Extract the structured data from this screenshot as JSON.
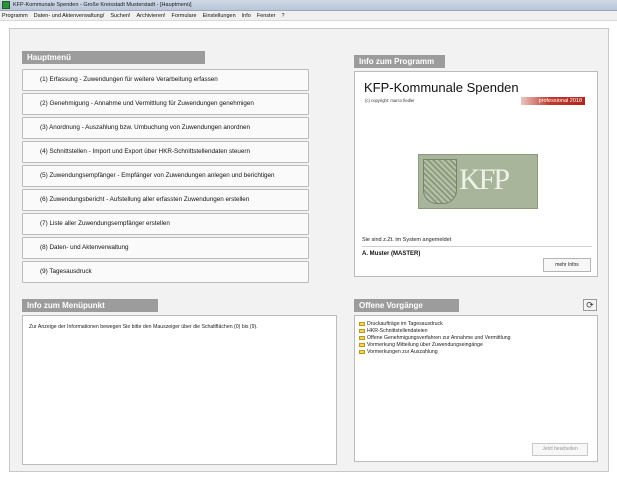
{
  "window": {
    "title": "KFP-Kommunale Spenden - Große Kreisstadt Musterstadt - [Hauptmenü]"
  },
  "menubar": [
    "Programm",
    "Daten- und Aktenverwaltung/",
    "Suchen!",
    "Archivieren!",
    "Formulare",
    "Einstellungen",
    "Info",
    "Fenster",
    "?"
  ],
  "main_menu": {
    "header": "Hauptmenü",
    "items": [
      "(1)  Erfassung - Zuwendungen für weitere Verarbeitung erfassen",
      "(2)  Genehmigung - Annahme und Vermittlung für Zuwendungen genehmigen",
      "(3)  Anordnung - Auszahlung bzw. Umbuchung von Zuwendungen anordnen",
      "(4)  Schnittstellen - Import und Export über HKR-Schnittstellendaten steuern",
      "(5)  Zuwendungsempfänger - Empfänger von Zuwendungen anlegen und berichtigen",
      "(6)  Zuwendungsbericht - Aufstellung aller erfassten Zuwendungen erstellen",
      "(7)  Liste aller Zuwendungsempfänger erstellen",
      "(8)  Daten- und Aktenverwaltung",
      "(9)  Tagesausdruck"
    ]
  },
  "program_info": {
    "header": "Info zum Programm",
    "title": "KFP-Kommunale Spenden",
    "copyright": "(c) copyright: marco fiedler",
    "edition": "professional  2018",
    "login_label": "Sie sind z.Zt. im System angemeldet",
    "user": "A. Muster  (MASTER)",
    "more_button": "mehr Infos"
  },
  "menu_info": {
    "header": "Info zum Menüpunkt",
    "text": "Zur Anzeige der Informationen bewegen Sie bitte den Mauszeiger über die Schaltflächen (0) bis (9)."
  },
  "open_tasks": {
    "header": "Offene Vorgänge",
    "items": [
      "Druckaufträge im Tagesausdruck",
      "HKR-Schnittstellendateien",
      "Offene Genehmigungsverfahren zur Annahme und Vermittlung",
      "Vormerkung Mitteilung über Zuwendungseingänge",
      "Vormerkungen zur Auszahlung"
    ],
    "edit_button": "Jetzt bearbeiten"
  },
  "colors": {
    "section_header": "#9c9c9c",
    "badge": "#c0392b",
    "folder": "#f3d35b"
  }
}
